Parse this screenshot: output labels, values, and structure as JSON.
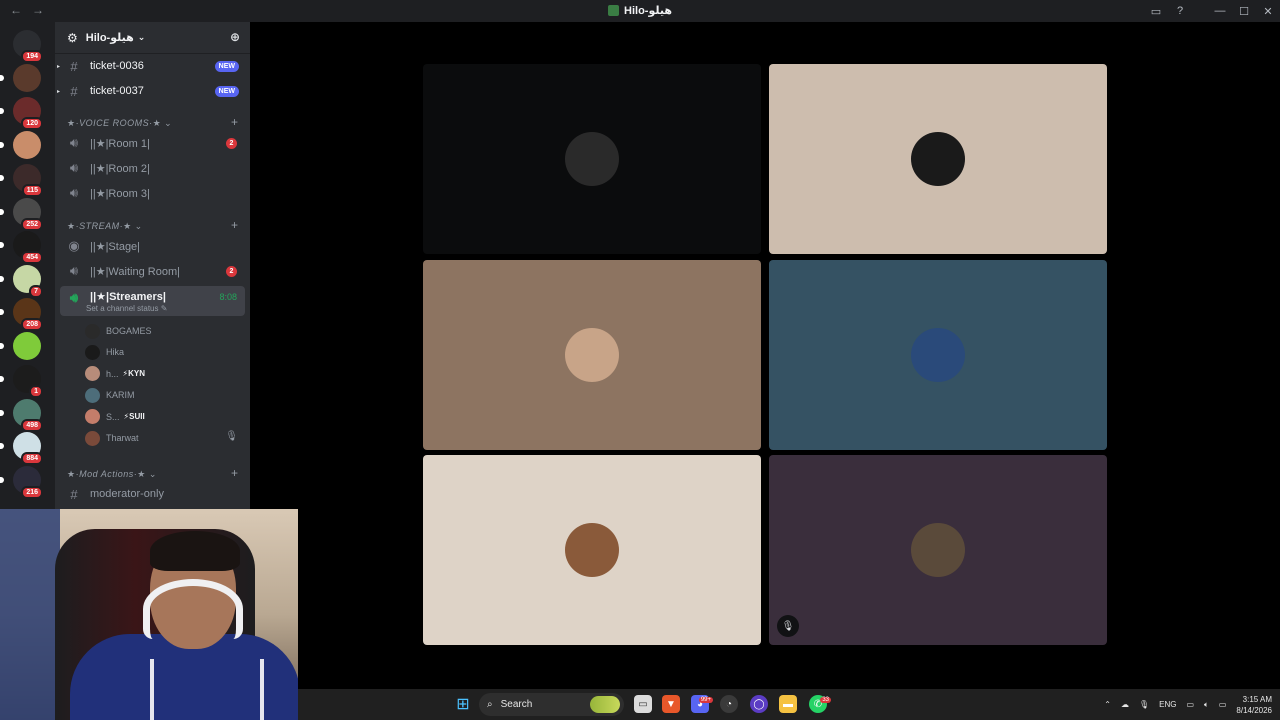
{
  "titlebar": {
    "back": "←",
    "forward": "→",
    "title": "Hilo-هيلو",
    "inbox_icon": "inbox-icon",
    "help": "?",
    "minimize": "—",
    "maximize": "☐",
    "close": "✕"
  },
  "servers": [
    {
      "name": "server-discord-home",
      "badge": "194",
      "color": "#2b2d31"
    },
    {
      "name": "server-1",
      "badge": "",
      "color": "#5a3a2c"
    },
    {
      "name": "server-2",
      "badge": "120",
      "color": "#6b2b2b"
    },
    {
      "name": "server-3",
      "badge": "",
      "color": "#c98d6a"
    },
    {
      "name": "server-4",
      "badge": "115",
      "color": "#3c2a2a"
    },
    {
      "name": "server-5",
      "badge": "252",
      "color": "#4a4a4a"
    },
    {
      "name": "server-6",
      "badge": "454",
      "color": "#1a1a1a"
    },
    {
      "name": "server-7",
      "badge": "7",
      "color": "#c6d7a5"
    },
    {
      "name": "server-8",
      "badge": "208",
      "color": "#5a3518"
    },
    {
      "name": "server-9",
      "badge": "",
      "color": "#7fcb3a"
    },
    {
      "name": "server-10",
      "badge": "1",
      "color": "#1c1c1c"
    },
    {
      "name": "server-11",
      "badge": "498",
      "color": "#4e7b6e"
    },
    {
      "name": "server-12",
      "badge": "884",
      "color": "#cfe0e6"
    },
    {
      "name": "server-13",
      "badge": "216",
      "color": "#2b2b3a"
    }
  ],
  "guild": {
    "name": "Hilo-هيلو",
    "chevron": "⌄"
  },
  "channels": {
    "ticket1": {
      "name": "ticket-0036",
      "badge": "NEW"
    },
    "ticket2": {
      "name": "ticket-0037",
      "badge": "NEW"
    },
    "cat_voice": "★·VOICE ROOMS·★",
    "room1": {
      "name": "||★|Room 1|",
      "count": "2"
    },
    "room2": {
      "name": "||★|Room 2|"
    },
    "room3": {
      "name": "||★|Room 3|"
    },
    "cat_stream": "★·STREAM·★",
    "stage": {
      "name": "||★|Stage|"
    },
    "waiting": {
      "name": "||★|Waiting Room|",
      "count": "2"
    },
    "streamers": {
      "name": "||★|Streamers|",
      "time": "8:08",
      "status": "Set a channel status"
    },
    "cat_mod": "★·Mod Actions·★",
    "modonly": {
      "name": "moderator-only"
    }
  },
  "voice_users": [
    {
      "name": "BOGAMES",
      "tag": "",
      "color": "#2a2a2a"
    },
    {
      "name": "Hika",
      "tag": "",
      "color": "#1a1a1a"
    },
    {
      "name": "h...",
      "tag": "⚡KYN",
      "color": "#b78c7a"
    },
    {
      "name": "KARIM",
      "tag": "",
      "color": "#4d6d7a"
    },
    {
      "name": "S...",
      "tag": "⚡SUII",
      "color": "#c47d6a"
    },
    {
      "name": "Tharwat",
      "tag": "",
      "color": "#7a4a3a"
    }
  ],
  "tiles": [
    {
      "name": "tile-user-1",
      "bg": "#0b0c0d",
      "avatar": "#2a2a2a",
      "muted": false
    },
    {
      "name": "tile-user-2",
      "bg": "#cdbdae",
      "avatar": "#1a1a1a",
      "muted": false
    },
    {
      "name": "tile-user-3",
      "bg": "#8d7461",
      "avatar": "#c8a488",
      "muted": false
    },
    {
      "name": "tile-user-4",
      "bg": "#355263",
      "avatar": "#2a4a7a",
      "muted": false
    },
    {
      "name": "tile-user-5",
      "bg": "#ded3c7",
      "avatar": "#8a5a3a",
      "muted": false
    },
    {
      "name": "tile-user-6",
      "bg": "#3a2e3c",
      "avatar": "#5a4a3a",
      "muted": true
    }
  ],
  "taskbar": {
    "search_label": "Search",
    "discord_badge": "99+",
    "whatsapp_badge": "33",
    "lang": "ENG",
    "time": "3:15 AM",
    "date": "8/14/2026"
  }
}
